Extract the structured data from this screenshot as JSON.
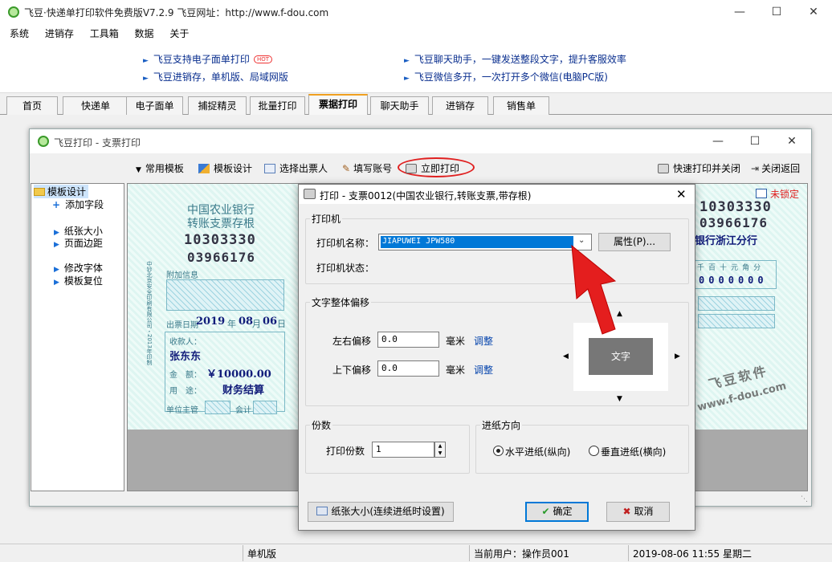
{
  "app": {
    "title": "飞豆·快递单打印软件免费版V7.2.9   飞豆网址：http://www.f-dou.com",
    "menu": [
      "系统",
      "进销存",
      "工具箱",
      "数据",
      "关于"
    ],
    "ads": [
      "飞豆支持电子面单打印",
      "飞豆进销存，单机版、局域网版",
      "飞豆聊天助手，一键发送整段文字，提升客服效率",
      "飞豆微信多开，一次打开多个微信(电脑PC版)"
    ],
    "hot_badge": "HOT",
    "tabs": [
      "首页",
      "快递单",
      "电子面单",
      "捕捉精灵",
      "批量打印",
      "票据打印",
      "聊天助手",
      "进销存",
      "销售单"
    ],
    "active_tab": "票据打印",
    "status": {
      "edition": "单机版",
      "user": "当前用户：操作员001",
      "datetime": "2019-08-06 11:55 星期二"
    }
  },
  "cheque_window": {
    "title": "飞豆打印 - 支票打印",
    "toolbar": {
      "templates": "常用模板",
      "design": "模板设计",
      "drawer": "选择出票人",
      "account": "填写账号",
      "print_now": "立即打印",
      "quick_print_close": "快速打印并关闭",
      "close_return": "关闭返回"
    },
    "tree": {
      "root": "模板设计",
      "items": [
        "添加字段",
        "纸张大小",
        "页面边距",
        "修改字体",
        "模板复位"
      ]
    },
    "cheque": {
      "bank": "中国农业银行",
      "kind": "转账支票存根",
      "code1": "10303330",
      "code2": "03966176",
      "extra_info": "附加信息",
      "issue_date_label": "出票日期",
      "year": "2019",
      "year_unit": "年",
      "month": "08",
      "month_unit": "月",
      "day": "06",
      "day_unit": "日",
      "payee_label": "收款人：",
      "payee": "张东东",
      "amount_label": "金　额：",
      "amount": "￥10000.00",
      "use_label": "用　途：",
      "use": "财务结算",
      "supervisor_label": "单位主管",
      "accountant_label": "会计",
      "side_text": "中钞北京安全印刷有限公司・2013年印制",
      "right_code1": "10303330",
      "right_code2": "03966176",
      "right_branch": "银行浙江分行",
      "lock": "未锁定",
      "digits_header": [
        "千",
        "百",
        "十",
        "元",
        "角",
        "分"
      ],
      "digits": [
        "0",
        "0",
        "0",
        "0",
        "0",
        "0",
        "0"
      ],
      "watermark1": "飞豆软件",
      "watermark2": "www.f-dou.com"
    }
  },
  "print_dialog": {
    "title": "打印 - 支票0012(中国农业银行,转账支票,带存根)",
    "printer_group": "打印机",
    "printer_name_label": "打印机名称：",
    "printer_name": "JIAPUWEI JPW580",
    "properties_button": "属性(P)...",
    "printer_status_label": "打印机状态：",
    "offset_group": "文字整体偏移",
    "lr_label": "左右偏移",
    "lr_value": "0.0",
    "ud_label": "上下偏移",
    "ud_value": "0.0",
    "unit": "毫米",
    "adjust": "调整",
    "preview_text": "文字",
    "copies_group": "份数",
    "copies_label": "打印份数",
    "copies_value": "1",
    "feed_group": "进纸方向",
    "feed_horizontal": "水平进纸(纵向)",
    "feed_vertical": "垂直进纸(横向)",
    "paper_button": "纸张大小(连续进纸时设置)",
    "ok_button": "确定",
    "cancel_button": "取消"
  },
  "colors": {
    "accent": "#0078d7",
    "link": "#0645ad",
    "highlight_red": "#e02020",
    "cheque_blue": "#111c7a"
  }
}
